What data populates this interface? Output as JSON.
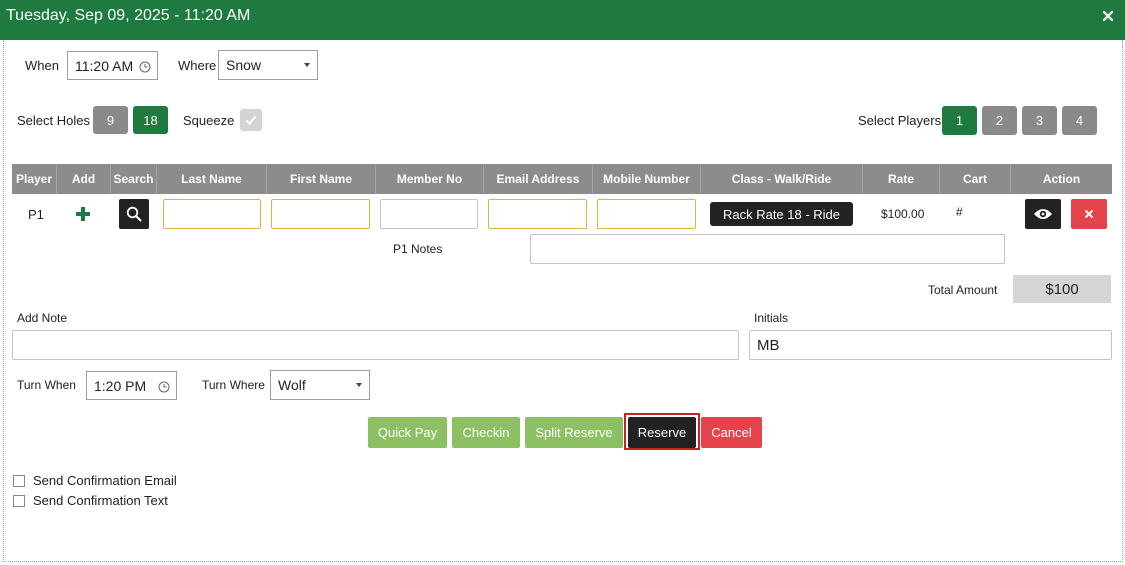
{
  "header": {
    "title": "Tuesday, Sep 09, 2025 - 11:20 AM",
    "close_glyph": "×"
  },
  "when": {
    "label": "When",
    "value": "11:20 AM"
  },
  "where": {
    "label": "Where",
    "value": "Snow"
  },
  "holes": {
    "label": "Select Holes",
    "options": [
      "9",
      "18"
    ],
    "selected": "18"
  },
  "squeeze": {
    "label": "Squeeze",
    "checked": true
  },
  "players": {
    "label": "Select Players",
    "options": [
      "1",
      "2",
      "3",
      "4"
    ],
    "selected": "1"
  },
  "table": {
    "headers": [
      "Player",
      "Add",
      "Search",
      "Last Name",
      "First Name",
      "Member No",
      "Email Address",
      "Mobile Number",
      "Class - Walk/Ride",
      "Rate",
      "Cart",
      "Action"
    ],
    "rows": [
      {
        "player": "P1",
        "last_name": "",
        "first_name": "",
        "member_no": "",
        "email": "",
        "mobile": "",
        "class": "Rack Rate 18 - Ride",
        "rate": "$100.00",
        "cart": "#"
      }
    ],
    "notes_label": "P1 Notes",
    "notes_value": ""
  },
  "total": {
    "label": "Total Amount",
    "value": "$100"
  },
  "add_note": {
    "label": "Add Note",
    "value": ""
  },
  "initials": {
    "label": "Initials",
    "value": "MB"
  },
  "turn_when": {
    "label": "Turn When",
    "value": "1:20 PM"
  },
  "turn_where": {
    "label": "Turn Where",
    "value": "Wolf"
  },
  "buttons": {
    "quick_pay": "Quick Pay",
    "checkin": "Checkin",
    "split_reserve": "Split Reserve",
    "reserve": "Reserve",
    "cancel": "Cancel"
  },
  "confirm": {
    "email_label": "Send Confirmation Email",
    "text_label": "Send Confirmation Text"
  },
  "colors": {
    "brand_green": "#1e7a3e",
    "light_green": "#8cc063",
    "cancel_red": "#e4434b",
    "highlight_red": "#c42424",
    "input_focus_orange": "#e0b243"
  }
}
